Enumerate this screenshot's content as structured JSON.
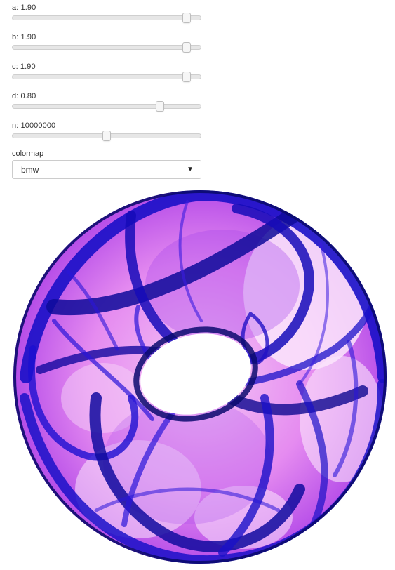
{
  "sliders": [
    {
      "label": "a: 1.90",
      "value": 1.9,
      "min": 0,
      "max": 2.0
    },
    {
      "label": "b: 1.90",
      "value": 1.9,
      "min": 0,
      "max": 2.0
    },
    {
      "label": "c: 1.90",
      "value": 1.9,
      "min": 0,
      "max": 2.0
    },
    {
      "label": "d: 0.80",
      "value": 0.8,
      "min": 0,
      "max": 1.0
    },
    {
      "label": "n: 10000000",
      "value": 0.5,
      "min": 0,
      "max": 1.0
    }
  ],
  "colormap": {
    "label": "colormap",
    "selected": "bmw",
    "caret_icon": "triangle-down-icon"
  },
  "colors": {
    "dark_blue": "#0b0b6e",
    "blue": "#2b16e0",
    "violet": "#9a2de6",
    "magenta": "#e84ef0",
    "pale": "#fbe8fc"
  }
}
